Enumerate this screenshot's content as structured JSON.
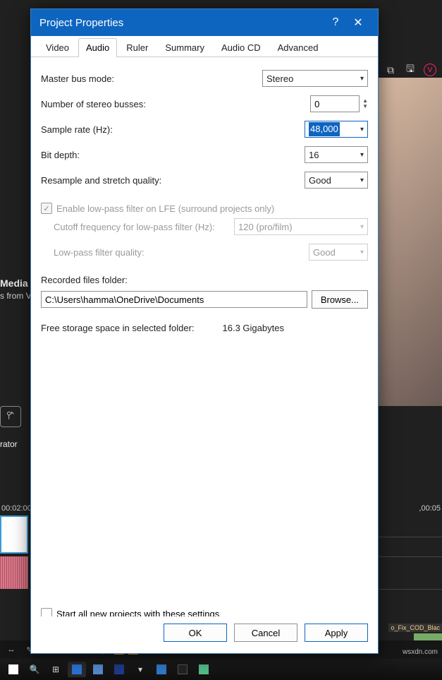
{
  "dialog": {
    "title": "Project Properties",
    "tabs": [
      "Video",
      "Audio",
      "Ruler",
      "Summary",
      "Audio CD",
      "Advanced"
    ],
    "active_tab_index": 1,
    "audio": {
      "master_bus_label": "Master bus mode:",
      "master_bus_value": "Stereo",
      "stereo_busses_label": "Number of stereo busses:",
      "stereo_busses_value": "0",
      "sample_rate_label": "Sample rate (Hz):",
      "sample_rate_value": "48,000",
      "bit_depth_label": "Bit depth:",
      "bit_depth_value": "16",
      "resample_label": "Resample and stretch quality:",
      "resample_value": "Good",
      "lfe_enable_label": "Enable low-pass filter on LFE (surround projects only)",
      "lfe_cutoff_label": "Cutoff frequency for low-pass filter (Hz):",
      "lfe_cutoff_value": "120 (pro/film)",
      "lfe_quality_label": "Low-pass filter quality:",
      "lfe_quality_value": "Good",
      "recorded_folder_label": "Recorded files folder:",
      "recorded_folder_value": "C:\\Users\\hamma\\OneDrive\\Documents",
      "browse_label": "Browse...",
      "free_space_label": "Free storage space in selected folder:",
      "free_space_value": "16.3 Gigabytes",
      "start_all_label": "Start all new projects with these settings"
    },
    "buttons": {
      "ok": "OK",
      "cancel": "Cancel",
      "apply": "Apply"
    }
  },
  "background": {
    "media_title": "Media",
    "media_sub": "s from V",
    "generator_label": "rator",
    "time_left": "00:02:00",
    "time_right": ",00:05",
    "clip_name_right": "o_Fix_COD_Blac",
    "watermark": "wsxdn.com"
  }
}
